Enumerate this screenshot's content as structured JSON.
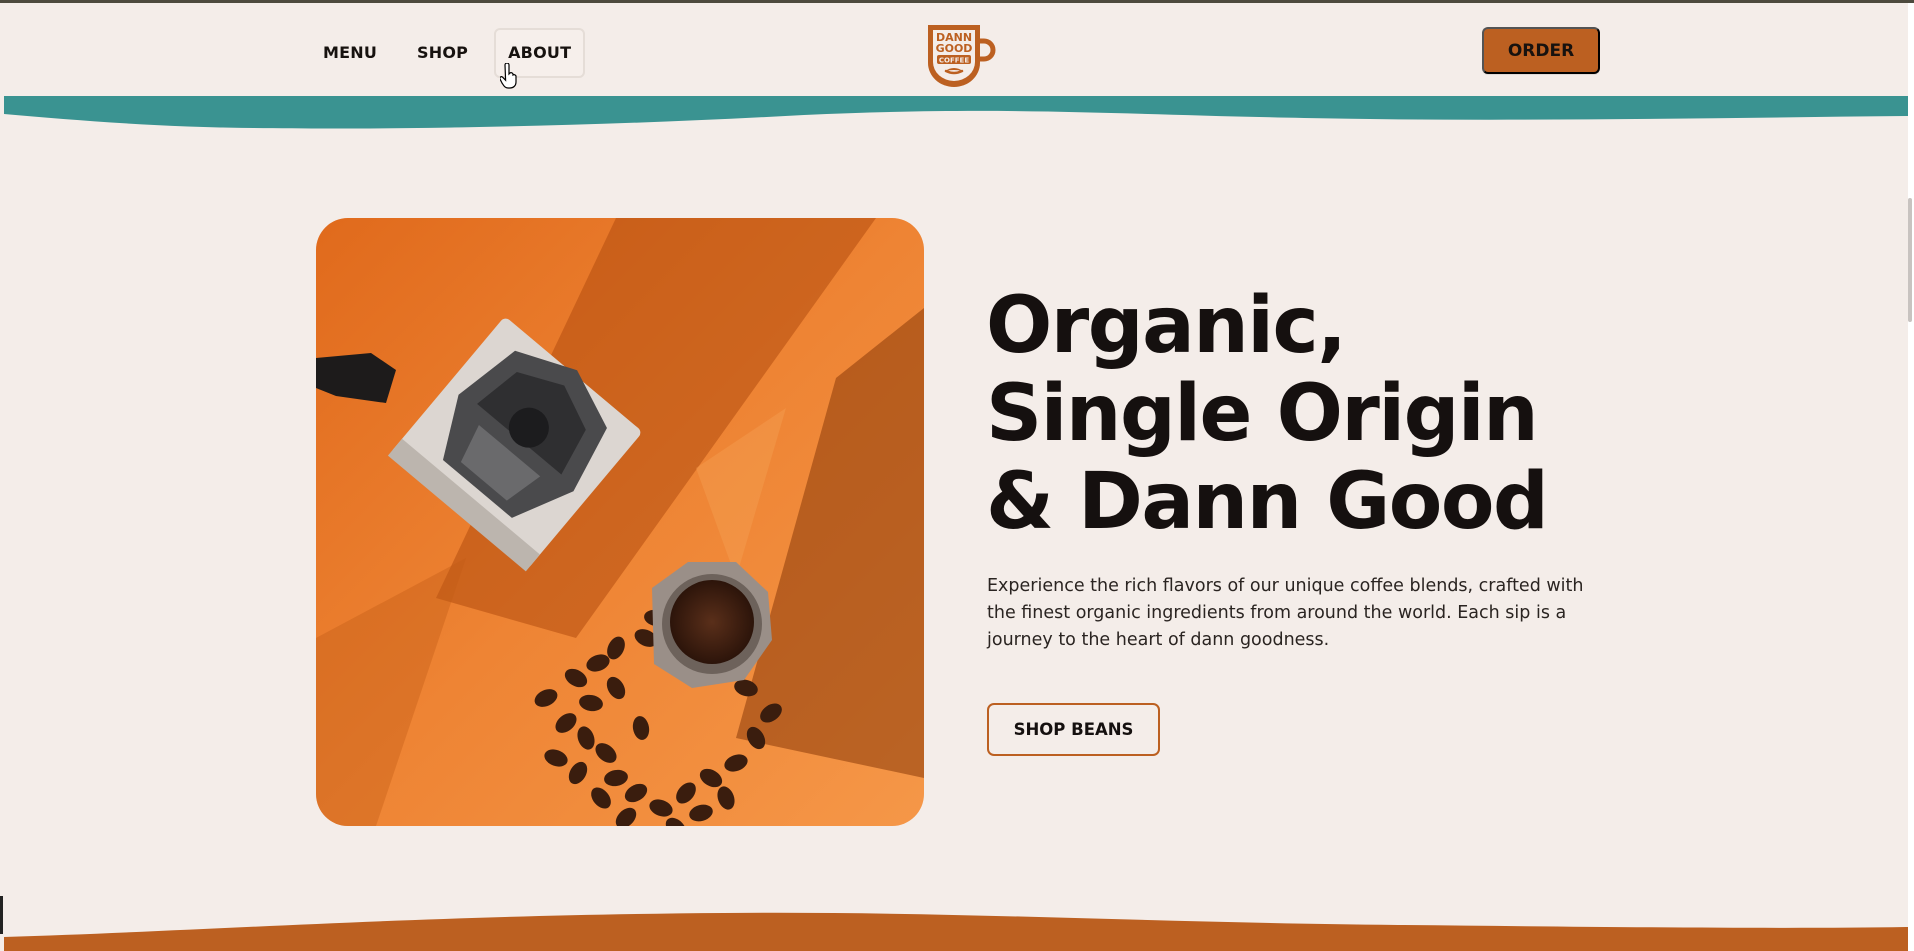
{
  "header": {
    "nav": [
      {
        "label": "MENU"
      },
      {
        "label": "SHOP"
      },
      {
        "label": "ABOUT"
      }
    ],
    "logo": {
      "line1": "DANN",
      "line2": "GOOD",
      "line3": "COFFEE"
    },
    "order_label": "ORDER"
  },
  "hero": {
    "title_lines": [
      "Organic,",
      "Single Origin",
      "& Dann Good"
    ],
    "description": "Experience the rich flavors of our unique coffee blends, crafted with the finest organic ingredients from around the world. Each sip is a journey to the heart of dann goodness.",
    "cta_label": "SHOP BEANS"
  },
  "colors": {
    "background": "#f4ede9",
    "accent_orange": "#bc6021",
    "accent_teal": "#3a9391",
    "text_dark": "#15100f"
  },
  "icons": {
    "cursor": "hand-pointer-icon",
    "logo": "coffee-mug-logo-icon"
  }
}
